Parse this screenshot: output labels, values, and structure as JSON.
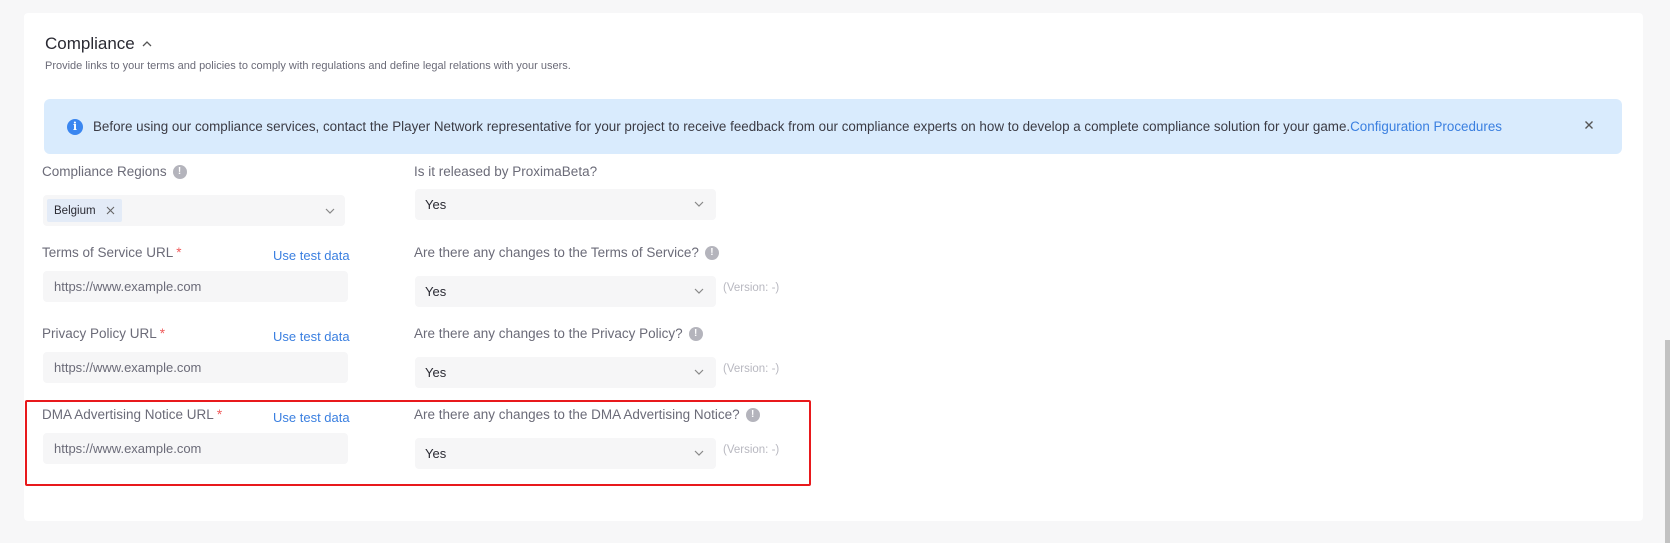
{
  "section": {
    "title": "Compliance",
    "collapse_icon": "chevron-up-icon",
    "description": "Provide links to your terms and policies to comply with regulations and define legal relations with your users."
  },
  "alert": {
    "icon": "info-icon",
    "text": "Before using our compliance services, contact the Player Network representative for your project to receive feedback from our compliance experts on how to develop a complete compliance solution for your game.",
    "link_label": "Configuration Procedures",
    "close_icon": "close-icon"
  },
  "fields": {
    "regions": {
      "label": "Compliance Regions",
      "help_icon": "info-exclamation-icon",
      "selected_tags": [
        "Belgium"
      ]
    },
    "released_by": {
      "label": "Is it released by ProximaBeta?",
      "value": "Yes"
    },
    "tos_url": {
      "label": "Terms of Service URL",
      "required_mark": "*",
      "test_link": "Use test data",
      "placeholder": "https://www.example.com"
    },
    "tos_changes": {
      "label": "Are there any changes to the Terms of Service?",
      "value": "Yes",
      "version": "(Version: -)"
    },
    "privacy_url": {
      "label": "Privacy Policy URL",
      "required_mark": "*",
      "test_link": "Use test data",
      "placeholder": "https://www.example.com"
    },
    "privacy_changes": {
      "label": "Are there any changes to the Privacy Policy?",
      "value": "Yes",
      "version": "(Version: -)"
    },
    "dma_url": {
      "label": "DMA Advertising Notice URL",
      "required_mark": "*",
      "test_link": "Use test data",
      "placeholder": "https://www.example.com"
    },
    "dma_changes": {
      "label": "Are there any changes to the DMA Advertising Notice?",
      "value": "Yes",
      "version": "(Version: -)"
    }
  },
  "colors": {
    "accent": "#3a7fe0",
    "alert_bg": "#d9ebfd",
    "required": "#ef5a5a",
    "highlight_border": "#e8191c"
  }
}
